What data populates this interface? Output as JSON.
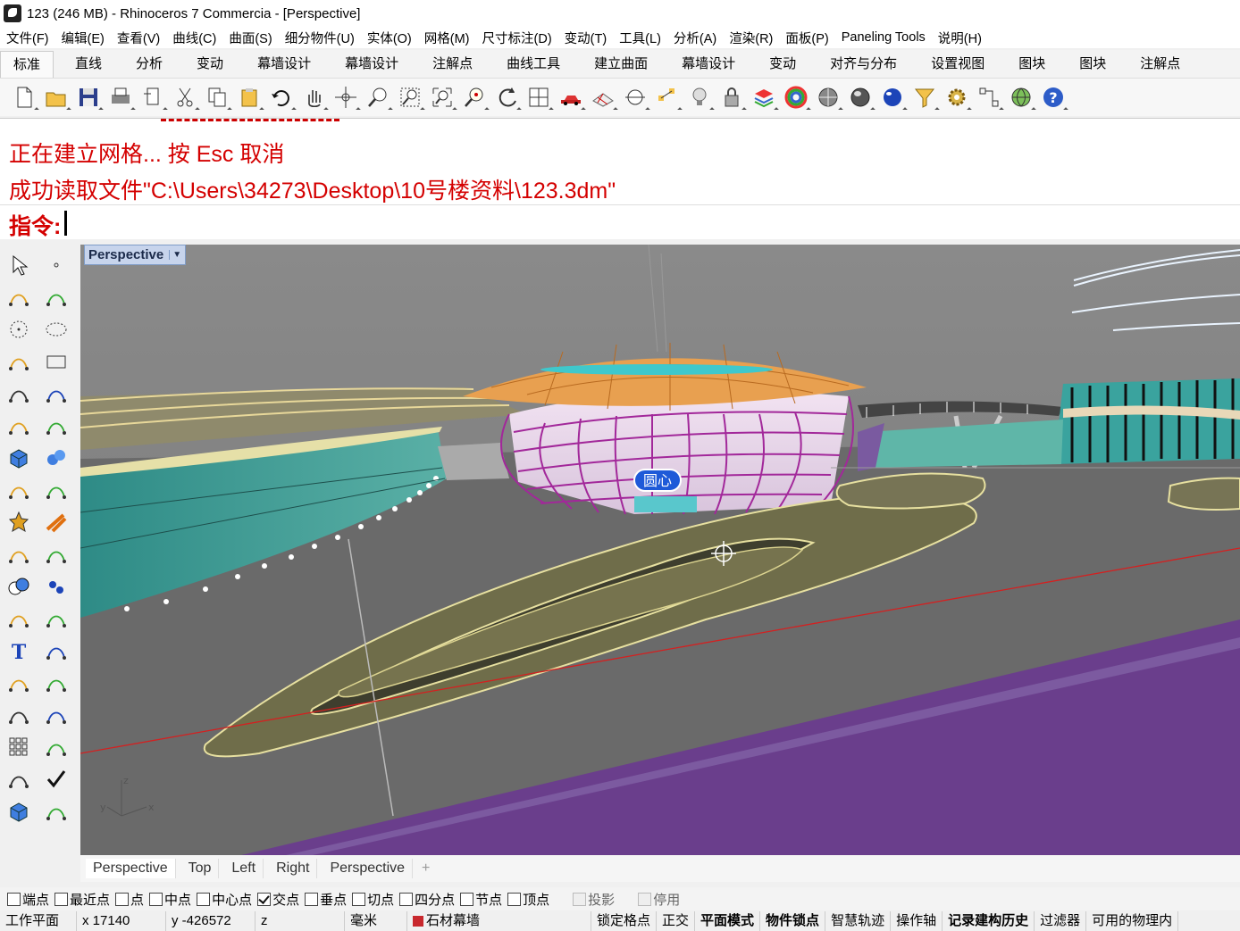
{
  "window": {
    "title": "123 (246 MB) - Rhinoceros 7 Commercia - [Perspective]"
  },
  "menu": [
    "文件(F)",
    "编辑(E)",
    "查看(V)",
    "曲线(C)",
    "曲面(S)",
    "细分物件(U)",
    "实体(O)",
    "网格(M)",
    "尺寸标注(D)",
    "变动(T)",
    "工具(L)",
    "分析(A)",
    "渲染(R)",
    "面板(P)",
    "Paneling Tools",
    "说明(H)"
  ],
  "toolbar_tabs": [
    "标准",
    "直线",
    "分析",
    "变动",
    "幕墙设计",
    "幕墙设计",
    "注解点",
    "曲线工具",
    "建立曲面",
    "幕墙设计",
    "变动",
    "对齐与分布",
    "设置视图",
    "图块",
    "图块",
    "注解点"
  ],
  "toolbar_icons": [
    "new-file-icon",
    "open-folder-icon",
    "save-icon",
    "print-icon",
    "import-icon",
    "cut-icon",
    "copy-icon",
    "paste-icon",
    "undo-icon",
    "pan-hand-icon",
    "rotate-view-icon",
    "zoom-icon",
    "zoom-window-icon",
    "zoom-extents-icon",
    "zoom-selected-icon",
    "rotate-icon",
    "four-viewports-icon",
    "car-icon",
    "grid-icon",
    "line-icon",
    "points-icon",
    "bulb-icon",
    "lock-icon",
    "layer-icon",
    "color-wheel-icon",
    "sphere-shaded-icon",
    "sphere-rendered-icon",
    "render-icon",
    "filter-icon",
    "settings-gear-icon",
    "snap-icon",
    "globe-icon",
    "help-icon"
  ],
  "command": {
    "history_line1": "正在建立网格... 按 Esc 取消",
    "history_line2": "成功读取文件\"C:\\Users\\34273\\Desktop\\10号楼资料\\123.3dm\"",
    "prompt": "指令:"
  },
  "viewport": {
    "label": "Perspective",
    "annotation": "圆心",
    "axis_x": "x",
    "axis_y": "y",
    "axis_z": "z"
  },
  "viewport_tabs": [
    "Perspective",
    "Top",
    "Left",
    "Right",
    "Perspective"
  ],
  "osnap": [
    {
      "label": "端点",
      "checked": false
    },
    {
      "label": "最近点",
      "checked": false
    },
    {
      "label": "点",
      "checked": false
    },
    {
      "label": "中点",
      "checked": false
    },
    {
      "label": "中心点",
      "checked": false
    },
    {
      "label": "交点",
      "checked": true
    },
    {
      "label": "垂点",
      "checked": false
    },
    {
      "label": "切点",
      "checked": false
    },
    {
      "label": "四分点",
      "checked": false
    },
    {
      "label": "节点",
      "checked": false
    },
    {
      "label": "顶点",
      "checked": false
    },
    {
      "label": "投影",
      "checked": false,
      "disabled": true
    },
    {
      "label": "停用",
      "checked": false,
      "disabled": true
    }
  ],
  "status": {
    "cplane": "工作平面",
    "x": "x 17140",
    "y": "y -426572",
    "z": "z",
    "units": "毫米",
    "layer": "石材幕墙",
    "layer_color": "#c8282d",
    "grid_snap": "锁定格点",
    "ortho": "正交",
    "planar": "平面模式",
    "osnap": "物件锁点",
    "smarttrack": "智慧轨迹",
    "gumball": "操作轴",
    "history": "记录建构历史",
    "filter": "过滤器",
    "physics": "可用的物理内"
  }
}
